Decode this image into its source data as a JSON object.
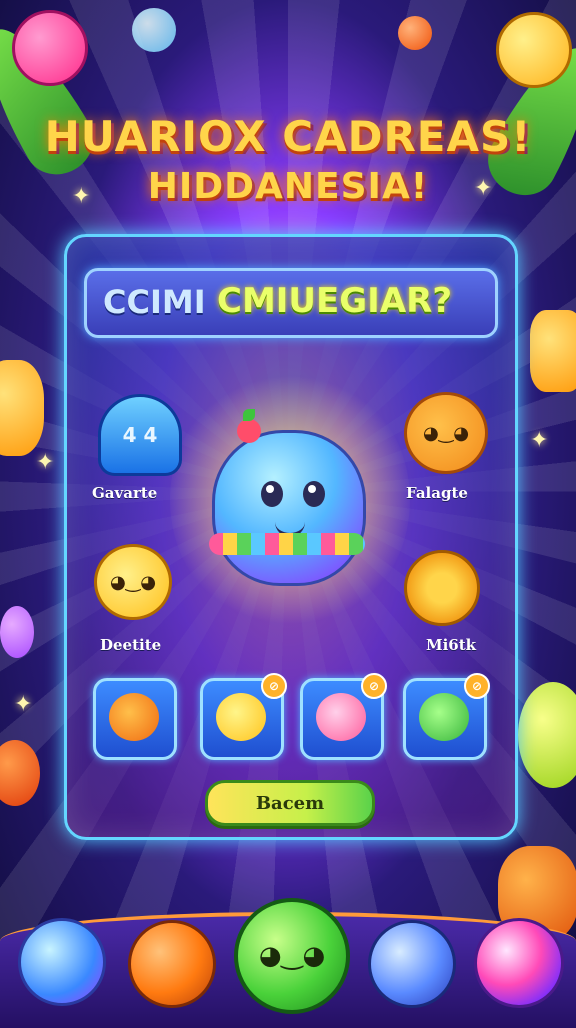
{
  "title": {
    "line1": "HUARIOX CADREAS!",
    "line2": "HIDDANESIA!"
  },
  "panel": {
    "banner_part1": "CCIMI",
    "banner_part2": "CMIUEGIAR?",
    "cap_icon_text": "4 4",
    "items": [
      {
        "label": "Gavarte"
      },
      {
        "label": "Falagte"
      },
      {
        "label": "Deetite"
      },
      {
        "label": "Mi6tk"
      }
    ],
    "slot_badges": [
      "⊘",
      "⊘",
      "⊘"
    ],
    "start_button": "Bacem"
  },
  "icons": {
    "cap": "cap-icon",
    "fox": "fox-icon",
    "chick": "chick-icon",
    "pizza": "pizza-icon"
  }
}
